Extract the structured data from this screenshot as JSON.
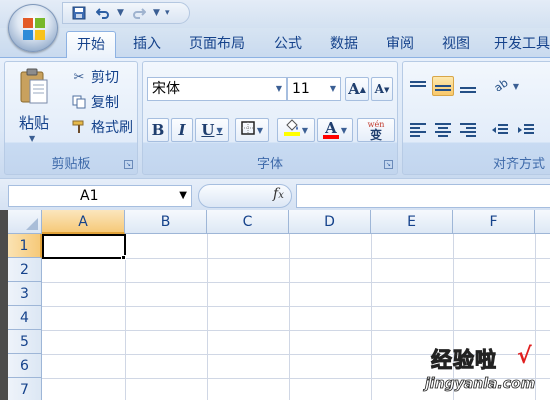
{
  "quick_access": {
    "save_icon": "save-icon",
    "undo_icon": "undo-icon",
    "redo_icon": "redo-icon",
    "customize": "▾"
  },
  "tabs": [
    "开始",
    "插入",
    "页面布局",
    "公式",
    "数据",
    "审阅",
    "视图",
    "开发工具"
  ],
  "active_tab": "开始",
  "ribbon": {
    "clipboard": {
      "label": "剪贴板",
      "paste": "粘贴",
      "cut": "剪切",
      "copy": "复制",
      "format_painter": "格式刷"
    },
    "font": {
      "label": "字体",
      "font_name": "宋体",
      "font_size": "11",
      "bold": "B",
      "italic": "I",
      "underline": "U",
      "grow": "A",
      "shrink": "A",
      "font_color": "A",
      "phonetic": "wén",
      "phonetic_char": "变",
      "highlight_color": "#ffff00",
      "font_color_value": "#ff0000"
    },
    "alignment": {
      "label": "对齐方式"
    }
  },
  "formula_bar": {
    "name_box": "A1",
    "fx": "fx",
    "value": ""
  },
  "columns": [
    "A",
    "B",
    "C",
    "D",
    "E",
    "F"
  ],
  "rows": [
    "1",
    "2",
    "3",
    "4",
    "5",
    "6",
    "7"
  ],
  "selected_cell": "A1",
  "watermark": {
    "line1": "经验啦",
    "check": "√",
    "line2": "jingyanla.com"
  }
}
